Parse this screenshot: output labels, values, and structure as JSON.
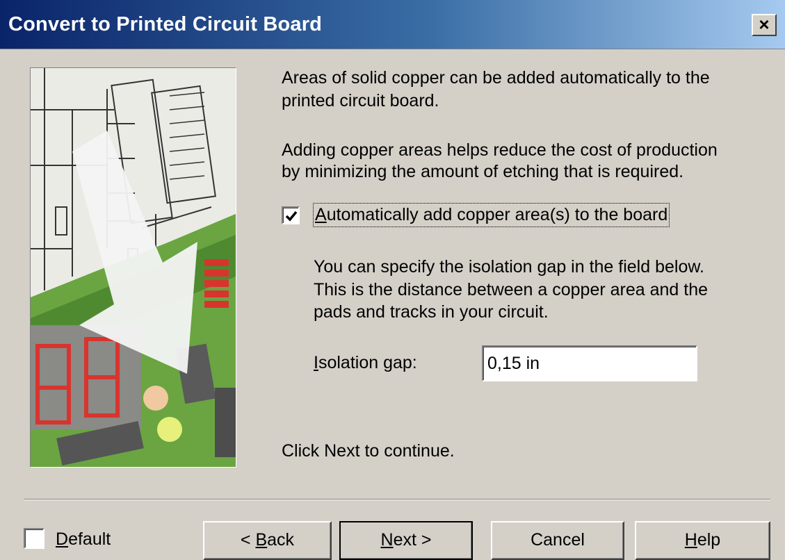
{
  "window": {
    "title": "Convert to Printed Circuit Board",
    "close_label": "×"
  },
  "content": {
    "paragraph1_line1": "Areas of solid copper can be added automatically to the",
    "paragraph1_line2": "printed circuit board.",
    "paragraph2_line1": "Adding copper areas helps reduce the cost of production",
    "paragraph2_line2": "by minimizing the amount of etching that is required.",
    "auto_copper_checkbox": {
      "label_prefix": "",
      "label_accel": "A",
      "label_rest": "utomatically add copper area(s) to the board",
      "checked": true
    },
    "isolation_info_line1": "You can specify the isolation gap in the field below.",
    "isolation_info_line2": "This is the distance between a copper area and the",
    "isolation_info_line3": "pads and tracks in your circuit.",
    "isolation_gap": {
      "label_accel": "I",
      "label_rest": "solation gap:",
      "value": "0,15 in"
    },
    "continue_hint": "Click Next to continue."
  },
  "footer": {
    "default_checkbox": {
      "label_accel": "D",
      "label_rest": "efault",
      "checked": false
    },
    "back_button": {
      "prefix": "< ",
      "accel": "B",
      "rest": "ack"
    },
    "next_button": {
      "accel": "N",
      "rest": "ext >"
    },
    "cancel_button": {
      "label": "Cancel"
    },
    "help_button": {
      "accel": "H",
      "rest": "elp"
    }
  },
  "colors": {
    "dialog_bg": "#d4d0c8",
    "title_start": "#0a246a",
    "title_end": "#a6caf0",
    "pcb_green": "#5f9a3a"
  },
  "side_image": {
    "icon": "pcb-schematic-illustration"
  }
}
